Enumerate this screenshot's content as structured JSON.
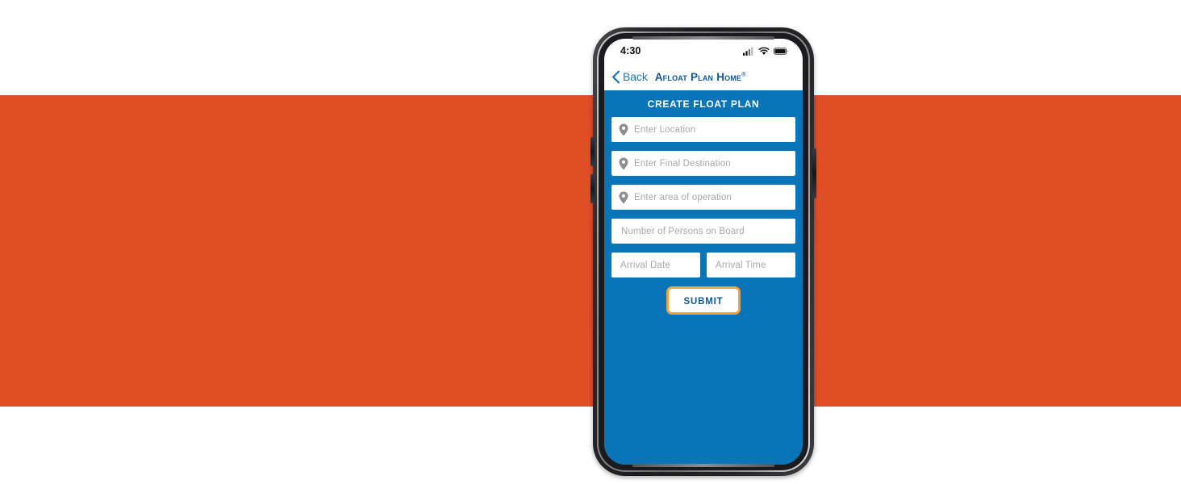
{
  "background": {
    "top_band_color": "#ffffff",
    "middle_band_color": "#e04e26",
    "bottom_band_color": "#ffffff"
  },
  "phone": {
    "frame_color": "#1c1c1f",
    "speaker_name": "earpiece-speaker",
    "buttons": [
      {
        "name": "volume-up-button"
      },
      {
        "name": "volume-down-button"
      },
      {
        "name": "power-button"
      }
    ]
  },
  "status_bar": {
    "time": "4:30",
    "icons": [
      "cellular-signal-icon",
      "wifi-icon",
      "battery-icon"
    ]
  },
  "nav_bar": {
    "back_icon": "chevron-left-icon",
    "back_label": "Back",
    "app_title": "Afloat Plan Home",
    "app_title_mark": "®",
    "title_color": "#10559c",
    "back_color": "#1278be"
  },
  "app": {
    "background_color": "#0a74b8",
    "section_title": "CREATE FLOAT PLAN",
    "fields": [
      {
        "name": "location-input",
        "placeholder": "Enter Location",
        "icon": "map-pin-icon",
        "value": ""
      },
      {
        "name": "final-destination-input",
        "placeholder": "Enter Final Destination",
        "icon": "map-pin-icon",
        "value": ""
      },
      {
        "name": "area-of-operation-input",
        "placeholder": "Enter area of operation",
        "icon": "map-pin-icon",
        "value": ""
      },
      {
        "name": "persons-on-board-input",
        "placeholder": "Number of Persons on Board",
        "icon": null,
        "value": ""
      }
    ],
    "arrival_fields": [
      {
        "name": "arrival-date-input",
        "placeholder": "Arrival Date",
        "value": ""
      },
      {
        "name": "arrival-time-input",
        "placeholder": "Arrival Time",
        "value": ""
      }
    ],
    "submit": {
      "label": "SUBMIT",
      "border_color": "#f2a13c",
      "text_color": "#10559c"
    }
  }
}
